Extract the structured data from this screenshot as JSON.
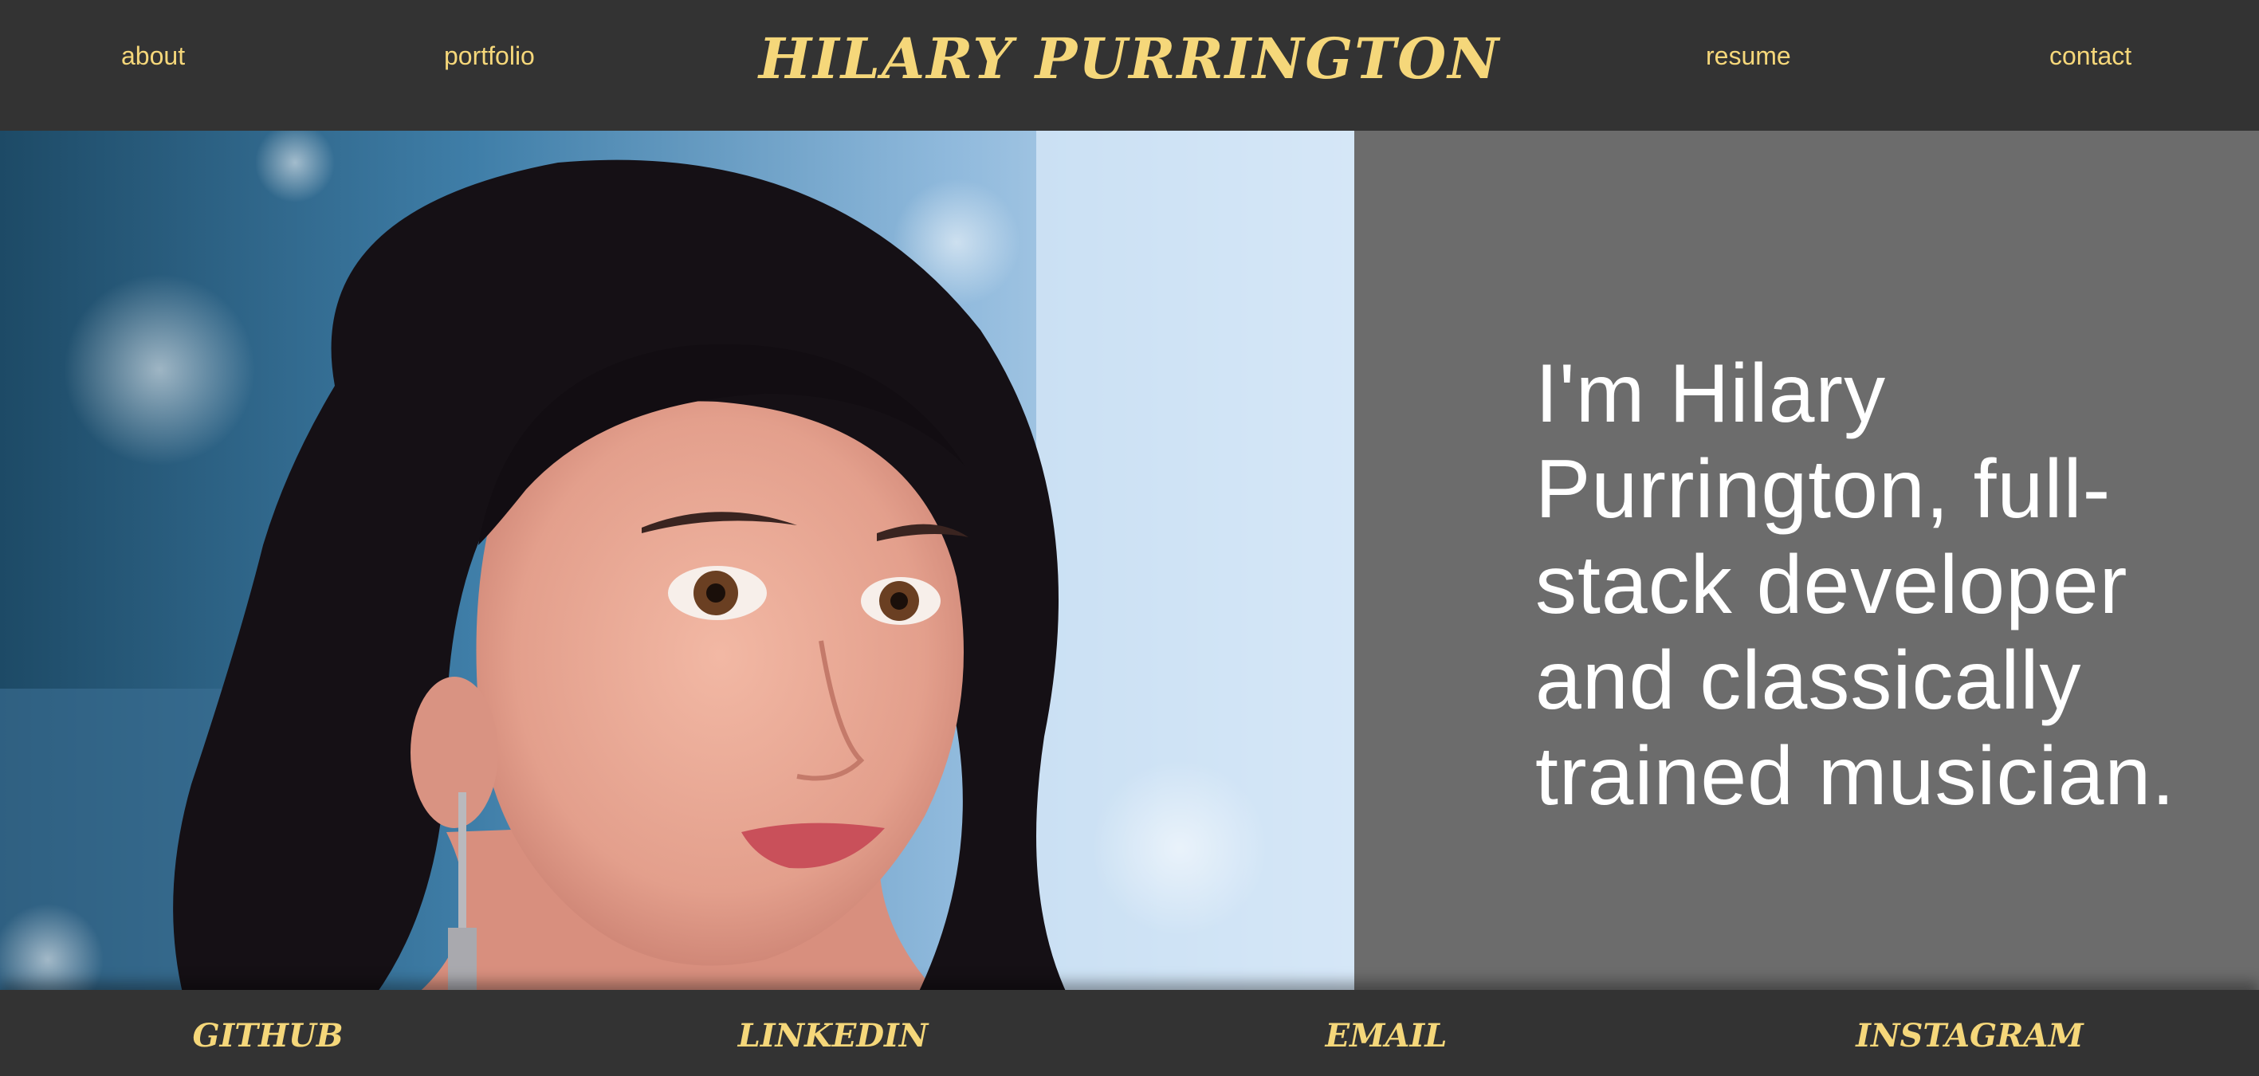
{
  "header": {
    "site_title": "Hilary Purrington",
    "nav": [
      {
        "label": "about"
      },
      {
        "label": "portfolio"
      },
      {
        "label": "resume"
      },
      {
        "label": "contact"
      }
    ]
  },
  "main": {
    "intro": "I'm Hilary Purrington, full-stack developer and classically trained musician."
  },
  "footer": {
    "links": [
      {
        "label": "GitHub"
      },
      {
        "label": "LinkedIn"
      },
      {
        "label": "Email"
      },
      {
        "label": "Instagram"
      }
    ]
  },
  "colors": {
    "background": "#333333",
    "accent": "#f5d77a",
    "intro_panel": "#6c6c6c",
    "intro_text": "#ffffff"
  }
}
